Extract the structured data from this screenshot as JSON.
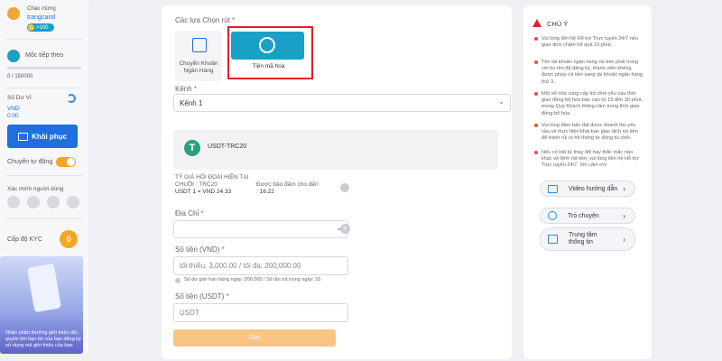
{
  "sidebar": {
    "greeting": "Chào mừng",
    "username": "trangcarol",
    "badge": ">100",
    "milestone_label": "Mốc tiếp theo",
    "progress_text": "0 / 150000",
    "progress_fraction": 0.0,
    "balance_label": "Số Dư Ví",
    "currency": "VND",
    "balance": "0.00",
    "restore_button": "Khôi phục",
    "auto_transfer_label": "Chuyển tự động",
    "auto_transfer_on": true,
    "verify_label": "Xác minh người dùng",
    "kyc_label": "Cấp độ KYC",
    "kyc_level": "0",
    "promo_text": "Nhận phần thưởng giới thiệu độc quyền khi bạn bè của bạn đăng ký sử dụng mã giới thiệu của bạn"
  },
  "withdraw": {
    "options_label": "Các lựa Chọn rút",
    "options": [
      {
        "label": "Chuyển Khoản Ngân Hàng"
      },
      {
        "label": "Tiền mã hóa"
      }
    ],
    "channel_label": "Kênh",
    "channel_value": "Kênh 1",
    "coin_name": "USDT-TRC20",
    "rate_title": "TỶ GIÁ HỐI ĐOÁI HIỆN TẠI",
    "chain": "CHUỖI : TRC20",
    "rate_value": "USDT 1 = VND 24.33",
    "guarantee_label": "Được bảo đảm cho đến",
    "guarantee_time": ": 16:22",
    "address_label": "Địa Chỉ",
    "amount_vnd_label": "Số tiền (VND)",
    "amount_vnd_placeholder": "tối thiểu: 3,000.00 / tối đa: 200,000.00",
    "limit_note": "Số dư giới hạn hàng ngày: 200,000 / Số lần rút trong ngày: 10",
    "amount_usdt_label": "Số tiền (USDT)",
    "amount_usdt_placeholder": "USDT",
    "submit_label": "Gửi"
  },
  "notice": {
    "title": "CHÚ Ý",
    "items": [
      "Vui lòng liên hệ Hỗ trợ Trực tuyến 24/7 nếu giao dịch chậm trễ quá 10 phút.",
      "Tên tài khoản ngân hàng rút tiền phải trùng với họ tên đã đăng ký, thành viên không được phép rút tiền sang tài khoản ngân hàng thứ 3.",
      "Một số nhà cung cấp trò chơi yêu cầu thời gian đồng bộ hóa báo cáo từ 15 đến 30 phút, mong Quý Khách thông cảm trong thời gian đồng bộ hóa.",
      "Vui lòng đảm bảo đạt được doanh thu yêu cầu và thực hiện khai báo giao dịch rút tiền để tránh rủi ro hệ thống tự động từ chối.",
      "Nếu có bất kỳ thay đổi hay thắc mắc nào khác về lệnh rút tiền, vui lòng liên hệ Hỗ trợ Trực tuyến 24/7. Xin cảm ơn!"
    ],
    "links": [
      {
        "label": "Video hướng dẫn",
        "icon": "video-icon"
      },
      {
        "label": "Trò chuyện",
        "icon": "chat-icon"
      },
      {
        "label": "Trung tâm thông tin",
        "icon": "info-center-icon"
      }
    ]
  },
  "colors": {
    "accent_blue": "#1e6fe0",
    "teal": "#1aa0c7",
    "orange": "#f5a623",
    "submit": "#f7c483",
    "highlight_red": "#e0202a"
  }
}
